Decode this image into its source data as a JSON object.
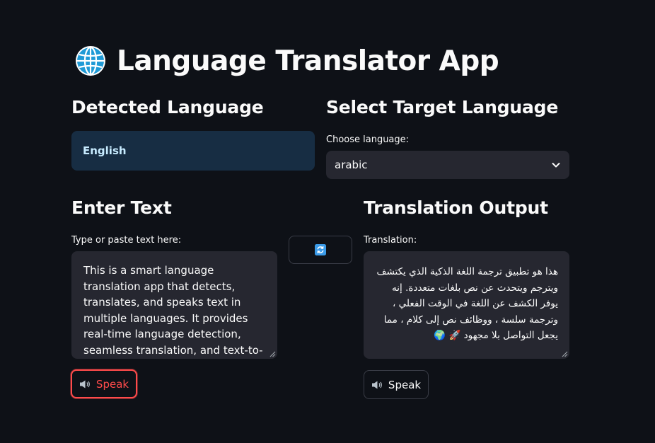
{
  "app": {
    "title": "Language Translator App",
    "globe_icon": "globe-icon"
  },
  "detected": {
    "heading": "Detected Language",
    "value": "English"
  },
  "target": {
    "heading": "Select Target Language",
    "label": "Choose language:",
    "selected": "arabic",
    "chevron_icon": "chevron-down-icon"
  },
  "input": {
    "heading": "Enter Text",
    "label": "Type or paste text here:",
    "text": "This is a smart language translation app that detects, translates, and speaks text in multiple languages. It provides real-time language detection, seamless translation, and text-to-speech functionality, making"
  },
  "swap": {
    "icon": "swap-icon"
  },
  "output": {
    "heading": "Translation Output",
    "label": "Translation:",
    "text": "هذا هو تطبيق ترجمة اللغة الذكية الذي يكتشف ويترجم ويتحدث عن نص بلغات متعددة. إنه يوفر الكشف عن اللغة في الوقت الفعلي ، وترجمة سلسة ، ووظائف نص إلى كلام ، مما يجعل التواصل بلا مجهود 🚀 🌍"
  },
  "speak_left": {
    "label": "Speak",
    "icon": "speaker-icon"
  },
  "speak_right": {
    "label": "Speak",
    "icon": "speaker-icon"
  },
  "colors": {
    "background": "#0e1117",
    "info_box": "#172d43",
    "info_text": "#c7ebff",
    "input_bg": "#262730",
    "accent_red": "#ff4b4b"
  }
}
